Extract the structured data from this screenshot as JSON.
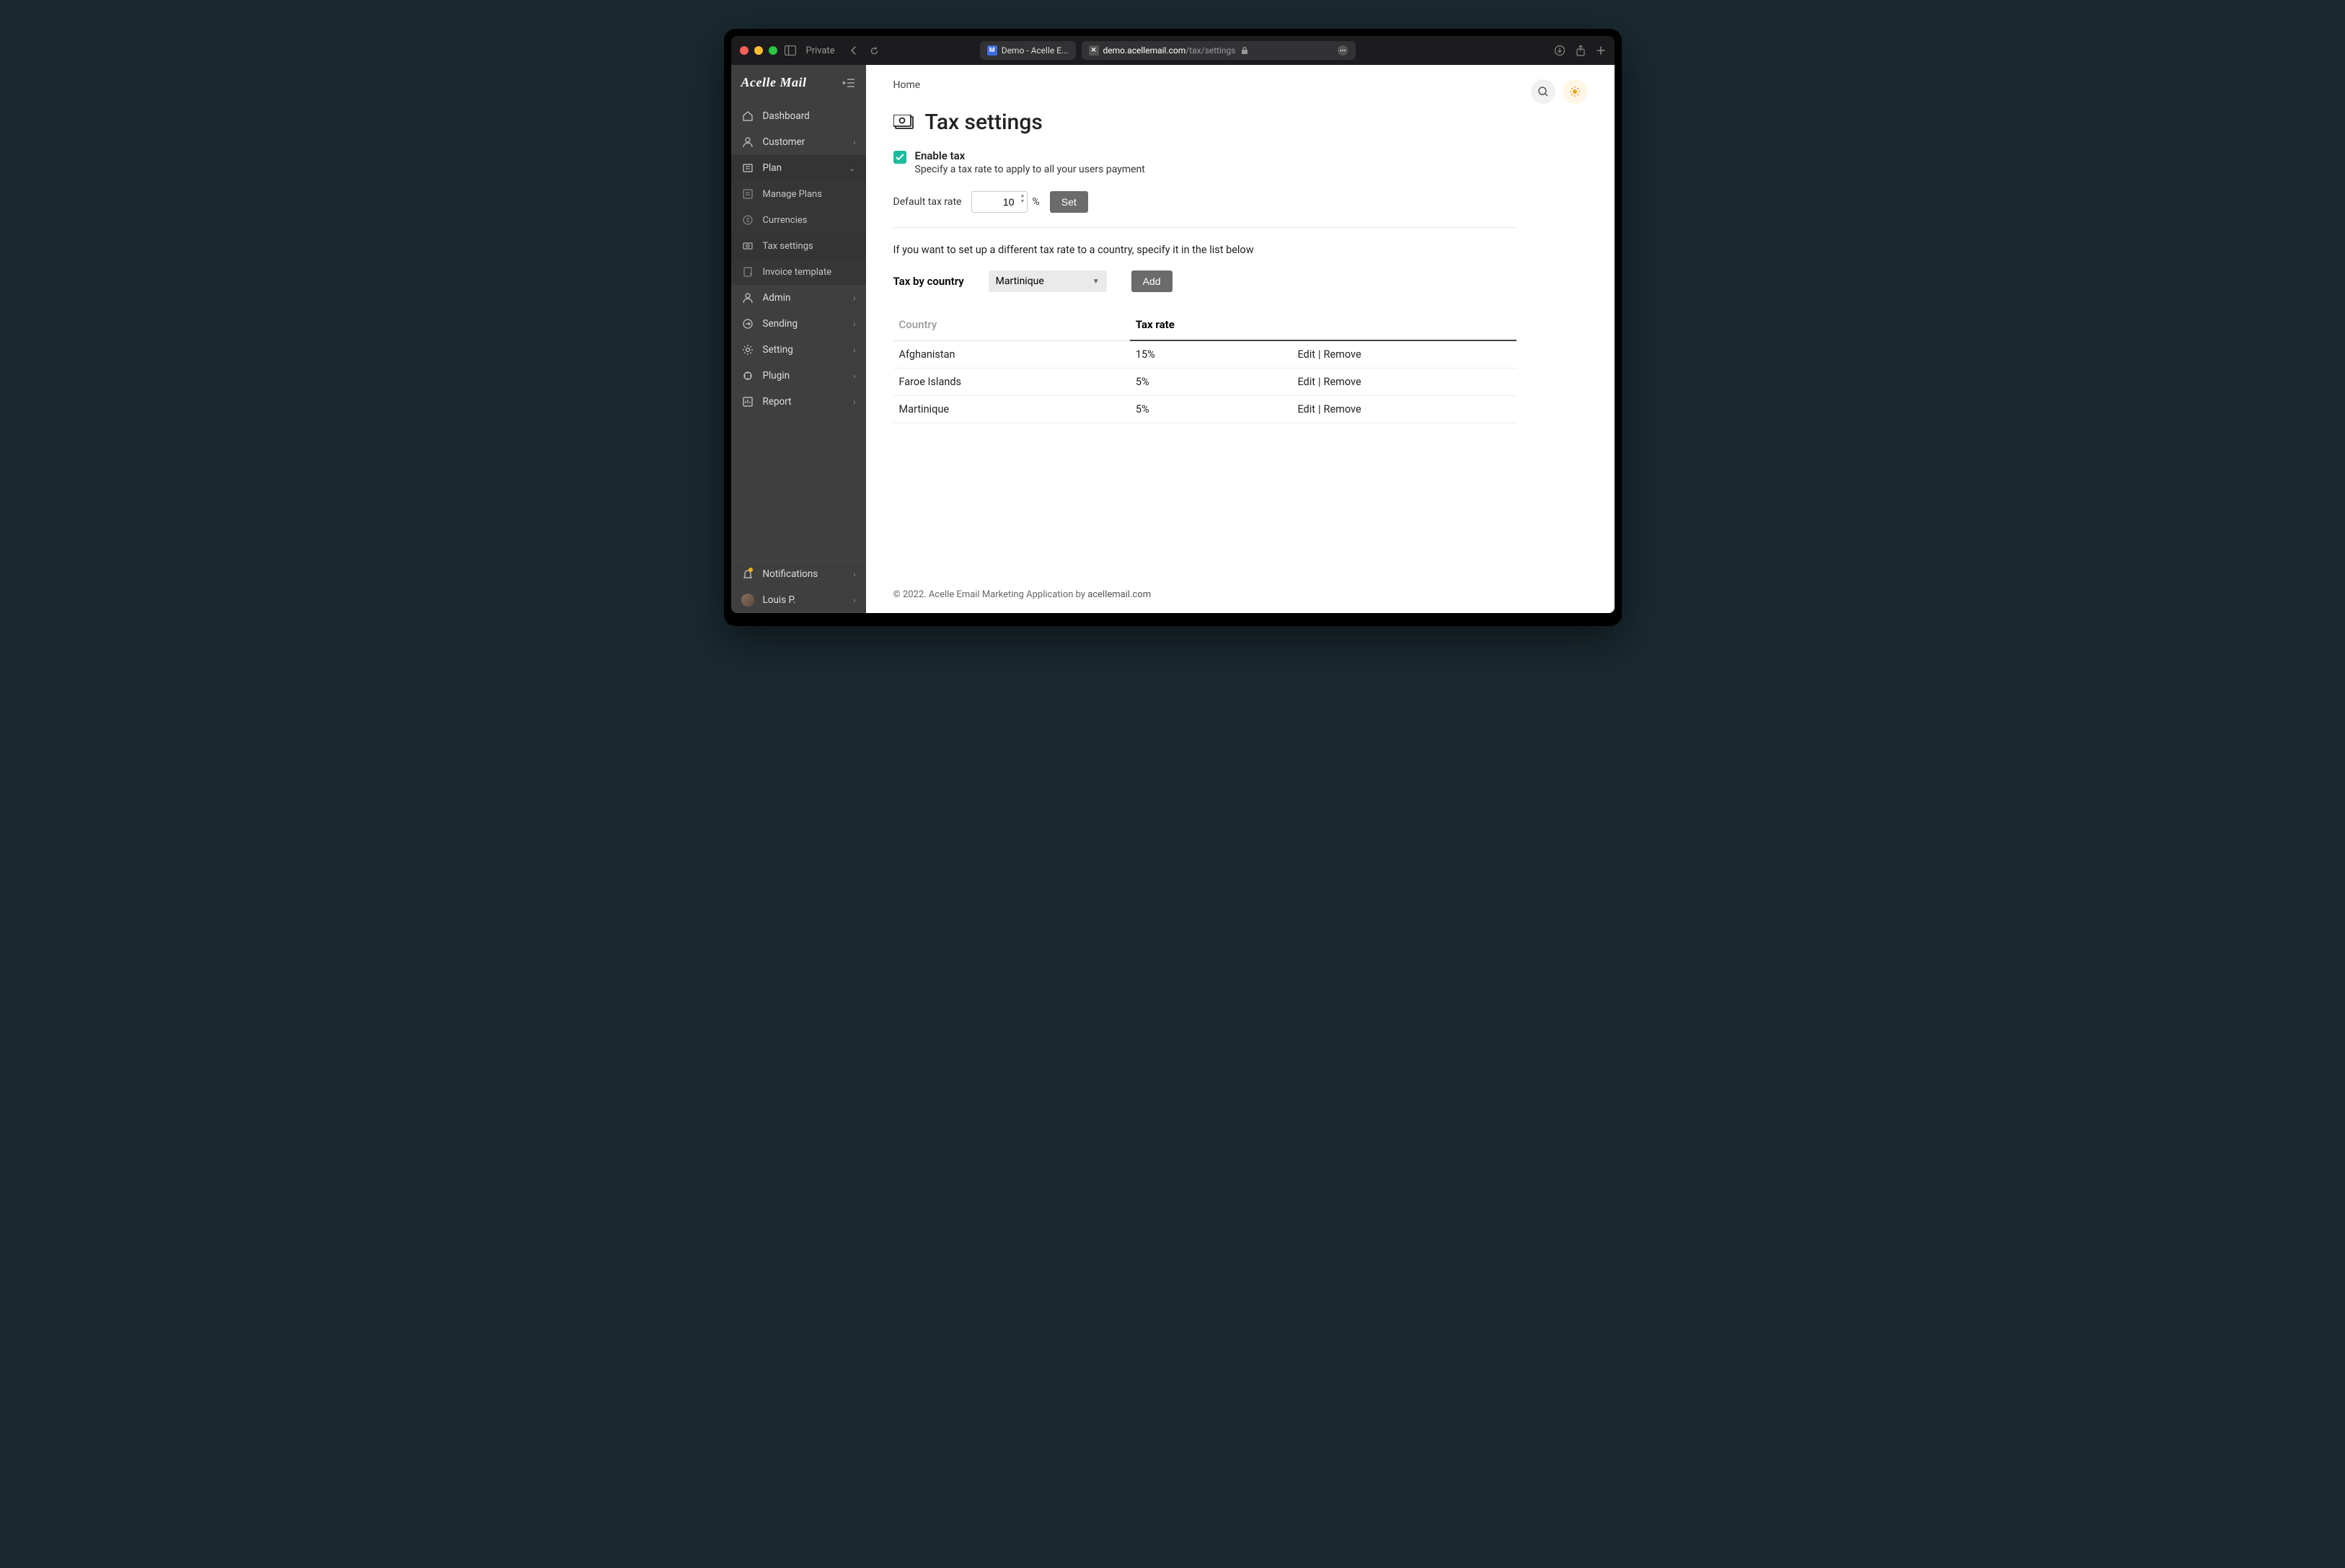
{
  "browser": {
    "private_label": "Private",
    "tab1_title": "Demo - Acelle E...",
    "url_host": "demo.acellemail.com",
    "url_path": "/tax/settings"
  },
  "sidebar": {
    "logo_text": "Acelle Mail",
    "items": [
      {
        "label": "Dashboard",
        "expandable": false
      },
      {
        "label": "Customer",
        "expandable": true
      },
      {
        "label": "Plan",
        "expandable": true
      }
    ],
    "plan_sub": [
      {
        "label": "Manage Plans"
      },
      {
        "label": "Currencies"
      },
      {
        "label": "Tax settings"
      },
      {
        "label": "Invoice template"
      }
    ],
    "items2": [
      {
        "label": "Admin",
        "expandable": true
      },
      {
        "label": "Sending",
        "expandable": true
      },
      {
        "label": "Setting",
        "expandable": true
      },
      {
        "label": "Plugin",
        "expandable": true
      },
      {
        "label": "Report",
        "expandable": true
      }
    ],
    "bottom": {
      "notifications": "Notifications",
      "user": "Louis P."
    }
  },
  "page": {
    "breadcrumb": "Home",
    "title": "Tax settings",
    "enable_title": "Enable tax",
    "enable_sub": "Specify a tax rate to apply to all your users payment",
    "default_rate_label": "Default tax rate",
    "default_rate_value": "10",
    "percent": "%",
    "set_btn": "Set",
    "note": "If you want to set up a different tax rate to a country, specify it in the list below",
    "country_label": "Tax by country",
    "country_select_value": "Martinique",
    "add_btn": "Add",
    "table": {
      "col_country": "Country",
      "col_rate": "Tax rate",
      "edit": "Edit",
      "remove": "Remove",
      "rows": [
        {
          "country": "Afghanistan",
          "rate": "15%"
        },
        {
          "country": "Faroe Islands",
          "rate": "5%"
        },
        {
          "country": "Martinique",
          "rate": "5%"
        }
      ]
    }
  },
  "footer": {
    "copy_prefix": "© 2022. Acelle Email Marketing Application by ",
    "copy_link": "acellemail.com"
  }
}
